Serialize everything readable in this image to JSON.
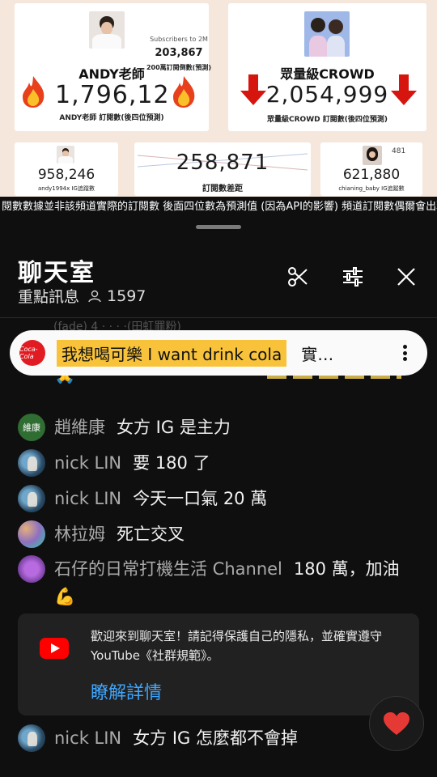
{
  "video": {
    "left_card": {
      "name": "ANDY老師",
      "count": "1,796,12",
      "sub_label": "ANDY老師 訂閱數(後四位預測)"
    },
    "center_badge": {
      "label": "Subscribers to 2M",
      "value": "203,867",
      "note": "200萬訂閱倒數(預測)"
    },
    "right_card": {
      "name": "眾量級CROWD",
      "count": "2,054,999",
      "sub_label": "眾量級CROWD 訂閱數(後四位預測)"
    },
    "bottom_left": {
      "count": "958,246",
      "label": "andy1994x IG追蹤數"
    },
    "bottom_center": {
      "count": "258,871",
      "label": "訂閱數差距"
    },
    "bottom_right": {
      "count": "621,880",
      "label": "chianing_baby IG追蹤數",
      "badge": "481"
    },
    "ticker": "閱數數據並非該頻道實際的訂閱數 後面四位數為預測值 (因為API的影響) 頻道訂閱數偶爾會出現巨"
  },
  "chat": {
    "title": "聊天室",
    "mode": "重點訊息",
    "viewer_count": "1597",
    "pinned": {
      "text": "我想喝可樂 I want drink cola",
      "trail": "實…",
      "logo_text": "Coca-Cola"
    },
    "faded_top": "(fade) 4 · · · ·(田虹罪粉)",
    "messages": [
      {
        "author": "",
        "text": "🙏",
        "avatar": ""
      },
      {
        "author": "趙維康",
        "text": "女方 IG 是主力",
        "avatar": "維康"
      },
      {
        "author": "nick LIN",
        "text": "要 180 了",
        "avatar": ""
      },
      {
        "author": "nick LIN",
        "text": "今天一口氣 20 萬",
        "avatar": ""
      },
      {
        "author": "林拉姆",
        "text": "死亡交叉",
        "avatar": ""
      },
      {
        "author": "石仔的日常打機生活 Channel",
        "text": "180 萬，加油💪",
        "avatar": ""
      },
      {
        "author": "nick LIN",
        "text": "女方 IG 怎麼都不會掉",
        "avatar": ""
      }
    ],
    "welcome": {
      "text": "歡迎來到聊天室！請記得保護自己的隱私，並確實遵守 YouTube《社群規範》。",
      "link": "瞭解詳情"
    }
  },
  "colors": {
    "background": "#0f0f0f",
    "pinned_highlight": "#f8c33a",
    "link": "#3ea6ff",
    "heart": "#e53935"
  }
}
